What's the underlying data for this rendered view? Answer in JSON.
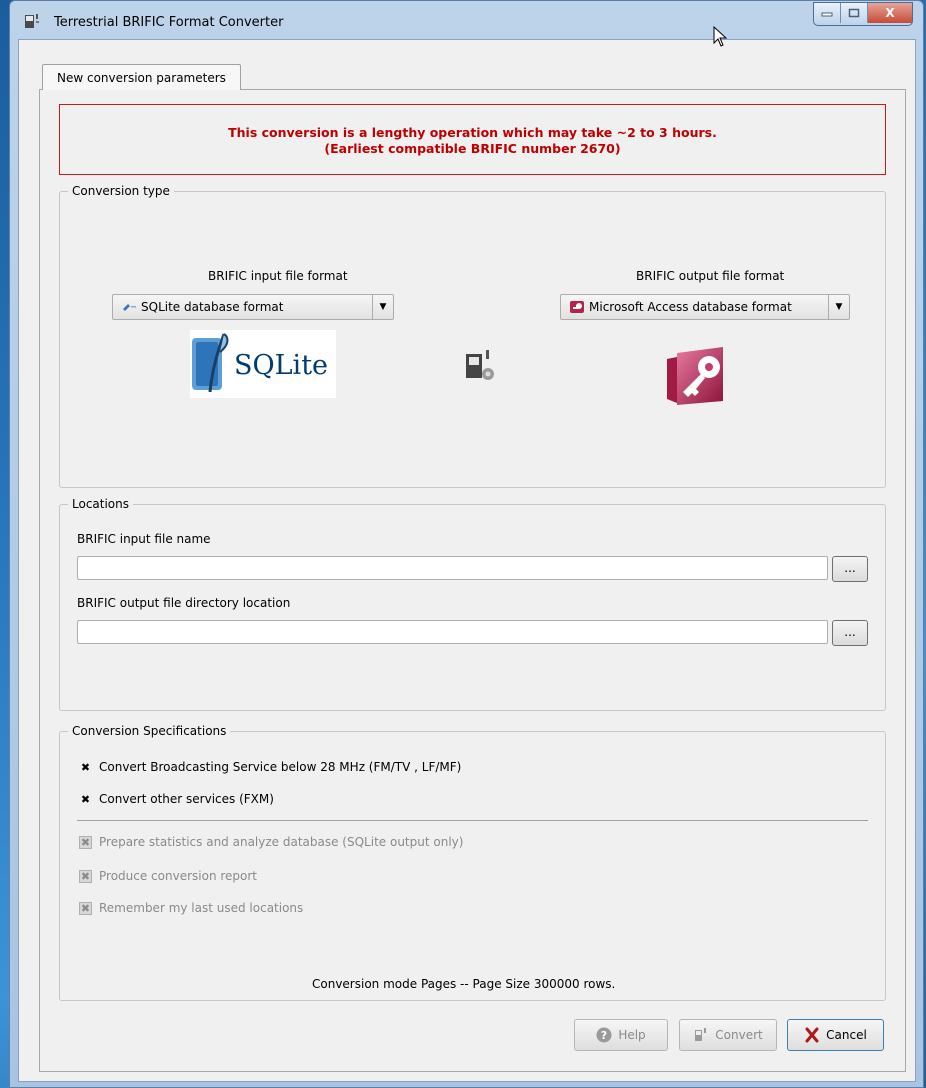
{
  "window": {
    "title": "Terrestrial BRIFIC Format Converter",
    "close_label": "X"
  },
  "tab": {
    "label": "New conversion parameters"
  },
  "warning": {
    "line1": "This conversion is a lengthy operation which may take ~2 to 3 hours.",
    "line2": "(Earliest compatible BRIFIC number 2670)"
  },
  "conversion_type": {
    "group_title": "Conversion type",
    "input_label": "BRIFIC input file format",
    "input_value": "SQLite database format",
    "output_label": "BRIFIC output file format",
    "output_value": "Microsoft Access database format",
    "sqlite_logo_text": "SQLite"
  },
  "locations": {
    "group_title": "Locations",
    "input_file_label": "BRIFIC input file name",
    "input_file_value": "",
    "output_dir_label": "BRIFIC output file directory location",
    "output_dir_value": "",
    "browse_label": "..."
  },
  "specifications": {
    "group_title": "Conversion Specifications",
    "options": [
      {
        "label": "Convert Broadcasting Service below 28 MHz (FM/TV , LF/MF)",
        "checked": true,
        "enabled": true
      },
      {
        "label": "Convert other services (FXM)",
        "checked": true,
        "enabled": true
      },
      {
        "label": "Prepare statistics and analyze database (SQLite output only)",
        "checked": true,
        "enabled": false
      },
      {
        "label": "Produce conversion report",
        "checked": true,
        "enabled": false
      },
      {
        "label": "Remember my last used locations",
        "checked": true,
        "enabled": false
      }
    ],
    "status_text": "Conversion mode Pages -- Page Size 300000 rows."
  },
  "buttons": {
    "help": "Help",
    "convert": "Convert",
    "cancel": "Cancel"
  },
  "colors": {
    "warning_text": "#c00000",
    "warning_border": "#c41c1c",
    "access_brand": "#b5224e"
  },
  "icons": [
    "app-icon",
    "minimize-icon",
    "maximize-icon",
    "close-icon",
    "sqlite-db-icon",
    "access-db-icon",
    "sqlite-logo",
    "convert-gear-icon",
    "access-key-logo",
    "help-icon",
    "cancel-x-icon",
    "mouse-cursor-icon"
  ]
}
